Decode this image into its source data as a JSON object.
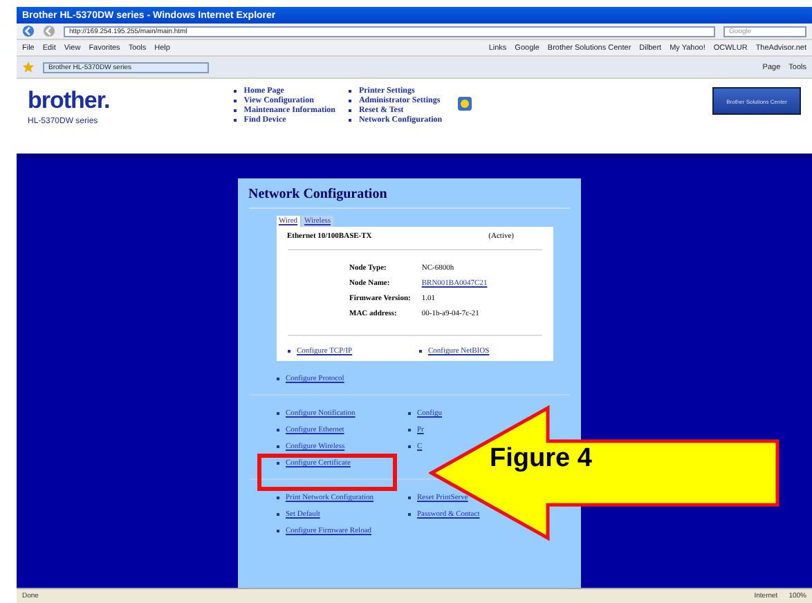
{
  "window": {
    "title": "Brother HL-5370DW series - Windows Internet Explorer"
  },
  "address_bar": {
    "url": "http://169.254.195.255/main/main.html"
  },
  "search_field": {
    "placeholder": "Google"
  },
  "menu_bar": [
    "File",
    "Edit",
    "View",
    "Favorites",
    "Tools",
    "Help"
  ],
  "links_bar": [
    "Links",
    "Google",
    "Brother Solutions Center",
    "Dilbert",
    "My Yahoo!",
    "OCWLUR",
    "TheAdvisor.net"
  ],
  "tab": {
    "title": "Brother HL-5370DW series"
  },
  "command_bar": [
    "Page",
    "Tools"
  ],
  "header": {
    "logo": "brother.",
    "model": "HL-5370DW series",
    "nav_left": [
      "Home Page",
      "View Configuration",
      "Maintenance Information",
      "Find Device"
    ],
    "nav_right": [
      "Printer Settings",
      "Administrator Settings",
      "Reset & Test",
      "Network Configuration"
    ],
    "banner": "Brother Solutions Center"
  },
  "panel": {
    "title": "Network Configuration",
    "tabs": [
      {
        "label": "Wired",
        "selected": true
      },
      {
        "label": "Wireless",
        "selected": false
      }
    ],
    "interface": "Ethernet 10/100BASE-TX",
    "status": "(Active)",
    "info": [
      {
        "label": "Node Type:",
        "value": "NC-6800h",
        "link": false
      },
      {
        "label": "Node Name:",
        "value": "BRN001BA0047C21",
        "link": true
      },
      {
        "label": "Firmware Version:",
        "value": "1.01",
        "link": false
      },
      {
        "label": "MAC address:",
        "value": "00-1b-a9-04-7c-21",
        "link": false
      }
    ],
    "link_groups": [
      [
        [
          "Configure TCP/IP",
          "Configure NetBIOS"
        ]
      ],
      [
        [
          "Configure Protocol"
        ]
      ],
      [
        [
          "Configure Notification",
          "Configu"
        ],
        [
          "Configure Ethernet",
          "Pr"
        ],
        [
          "Configure Wireless",
          "C"
        ],
        [
          "Configure Certificate"
        ]
      ],
      [
        [
          "Print Network Configuration",
          "Reset PrintServe"
        ],
        [
          "Set Default",
          "Password & Contact"
        ],
        [
          "Configure Firmware Reload"
        ]
      ]
    ]
  },
  "annotation": {
    "label": "Figure 4"
  },
  "status_bar": {
    "status": "Done",
    "zone": "Internet",
    "zoom": "100%"
  }
}
